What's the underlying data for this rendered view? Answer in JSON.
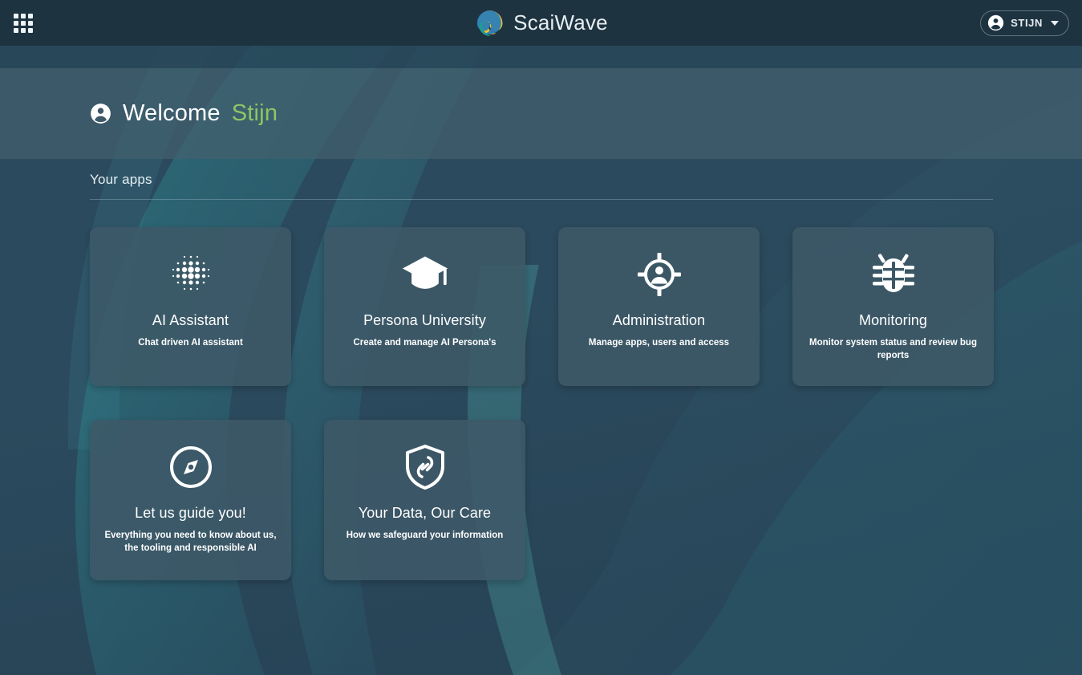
{
  "topbar": {
    "apps_launcher_icon": "grid-apps-icon",
    "brand_name": "ScaiWave",
    "brand_logo_icon": "scaiwave-swirl-logo",
    "user": {
      "label": "STIJN",
      "avatar_icon": "account-circle-icon",
      "chevron_icon": "chevron-down-icon"
    }
  },
  "banner": {
    "icon": "account-circle-icon",
    "greeting": "Welcome",
    "user_name": "Stijn"
  },
  "main": {
    "section_title": "Your apps",
    "cards": [
      {
        "title": "AI Assistant",
        "description": "Chat driven AI assistant",
        "icon": "dot-matrix-icon"
      },
      {
        "title": "Persona University",
        "description": "Create and manage AI Persona's",
        "icon": "graduation-cap-icon"
      },
      {
        "title": "Administration",
        "description": "Manage apps, users and access",
        "icon": "person-crosshair-icon"
      },
      {
        "title": "Monitoring",
        "description": "Monitor system status and review bug reports",
        "icon": "bug-icon"
      },
      {
        "title": "Let us guide you!",
        "description": "Everything you need to know about us, the tooling and responsible AI",
        "icon": "compass-icon"
      },
      {
        "title": "Your Data, Our Care",
        "description": "How we safeguard your information",
        "icon": "shield-link-icon"
      }
    ]
  },
  "colors": {
    "page_background": "#2c4a5e",
    "topbar_background": "#1e3340",
    "strip_background": "#2b4557",
    "banner_background": "#3e5a69",
    "card_background": "#3d5867",
    "accent_green": "#8cc665",
    "text_primary": "#ffffff",
    "logo_blue": "#2b7fb8",
    "logo_yellow": "#f2c12e",
    "logo_teal": "#1f9d8e"
  }
}
